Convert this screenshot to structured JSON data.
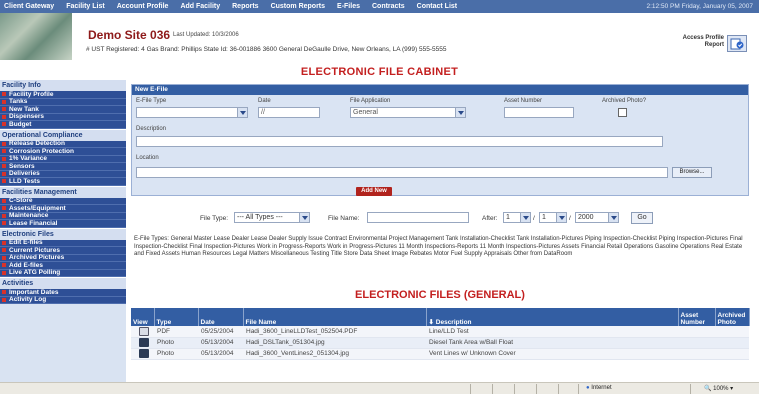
{
  "topnav": {
    "items": [
      "Client Gateway",
      "Facility List",
      "Account Profile",
      "Add Facility",
      "Reports",
      "Custom Reports",
      "E-Files",
      "Contracts",
      "Contact List"
    ],
    "datetime": "2:12:50 PM  Friday, January 05, 2007"
  },
  "header": {
    "site_title": "Demo Site 036",
    "last_updated": "Last Updated: 10/3/2006",
    "site_info": "# UST Registered: 4   Gas Brand: Phillips   State Id: 36-001886   3600 General DeGaulle Drive, New Orleans, LA   (999) 555-5555",
    "access_profile": "Access Profile Report"
  },
  "page_heading": "ELECTRONIC FILE CABINET",
  "sidebar": {
    "sections": [
      {
        "title": "Facility Info",
        "items": [
          "Facility Profile",
          "Tanks",
          "New Tank",
          "Dispensers",
          "Budget"
        ]
      },
      {
        "title": "Operational Compliance",
        "items": [
          "Release Detection",
          "Corrosion Protection",
          "1% Variance",
          "Sensors",
          "Deliveries",
          "LLD Tests"
        ]
      },
      {
        "title": "Facilities Management",
        "items": [
          "C-Store",
          "Assets/Equipment",
          "Maintenance",
          "Lease Financial"
        ]
      },
      {
        "title": "Electronic Files",
        "items": [
          "Edit E-files",
          "Current Pictures",
          "Archived Pictures",
          "Add E-files",
          "Live ATG Polling"
        ]
      },
      {
        "title": "Activities",
        "items": [
          "Important Dates",
          "Activity Log"
        ]
      }
    ]
  },
  "new_efile": {
    "title": "New E-File",
    "efile_type_label": "E-File Type",
    "efile_type_value": "",
    "date_label": "Date",
    "date_value": "//",
    "file_app_label": "File Application",
    "file_app_value": "General",
    "asset_number_label": "Asset Number",
    "archived_label": "Archived Photo?",
    "description_label": "Description",
    "location_label": "Location",
    "browse_label": "Browse...",
    "add_label": "Add New"
  },
  "filter": {
    "file_type_label": "File Type:",
    "file_type_value": "--- All Types ---",
    "file_name_label": "File Name:",
    "after_label": "After:",
    "month_value": "1",
    "day_value": "1",
    "year_value": "2000",
    "go_label": "Go"
  },
  "types_text": "E-File Types: General  Master Lease  Dealer Lease  Dealer Supply  Issue  Contract  Environmental  Project Management  Tank Installation-Checklist  Tank Installation-Pictures  Piping Inspection-Checklist  Piping Inspection-Pictures  Final Inspection-Checklist  Final Inspection-Pictures  Work in Progress-Reports  Work in Progress-Pictures  11 Month Inspections-Reports  11 Month Inspections-Pictures  Assets  Financial  Retail Operations  Gasoline Operations  Real Estate and Fixed Assets  Human Resources  Legal Matters  Miscellaneous  Testing  Title  Store Data Sheet  Image Rebates  Motor Fuel Supply  Appraisals  Other from DataRoom",
  "files_heading": "ELECTRONIC FILES (GENERAL)",
  "files_table": {
    "headers": {
      "view": "View",
      "type": "Type",
      "date": "Date",
      "file_name": "File Name",
      "description": "Description",
      "asset_number": "Asset Number",
      "archived_photo": "Archived Photo"
    },
    "rows": [
      {
        "type": "PDF",
        "date": "05/25/2004",
        "file_name": "Hadi_3600_LineLLDTest_052504.PDF",
        "description": "Line/LLD Test"
      },
      {
        "type": "Photo",
        "date": "05/13/2004",
        "file_name": "Hadi_DSLTank_051304.jpg",
        "description": "Diesel Tank Area w/Ball Float"
      },
      {
        "type": "Photo",
        "date": "05/13/2004",
        "file_name": "Hadi_3600_VentLines2_051304.jpg",
        "description": "Vent Lines w/ Unknown Cover"
      }
    ]
  },
  "statusbar": {
    "zone": "Internet",
    "zoom": "100%"
  },
  "colors": {
    "nav_bg": "#4a6ea8",
    "sidebar_item_bg": "#2e4f96",
    "heading_red": "#c31f1f",
    "button_red": "#b1231d"
  }
}
